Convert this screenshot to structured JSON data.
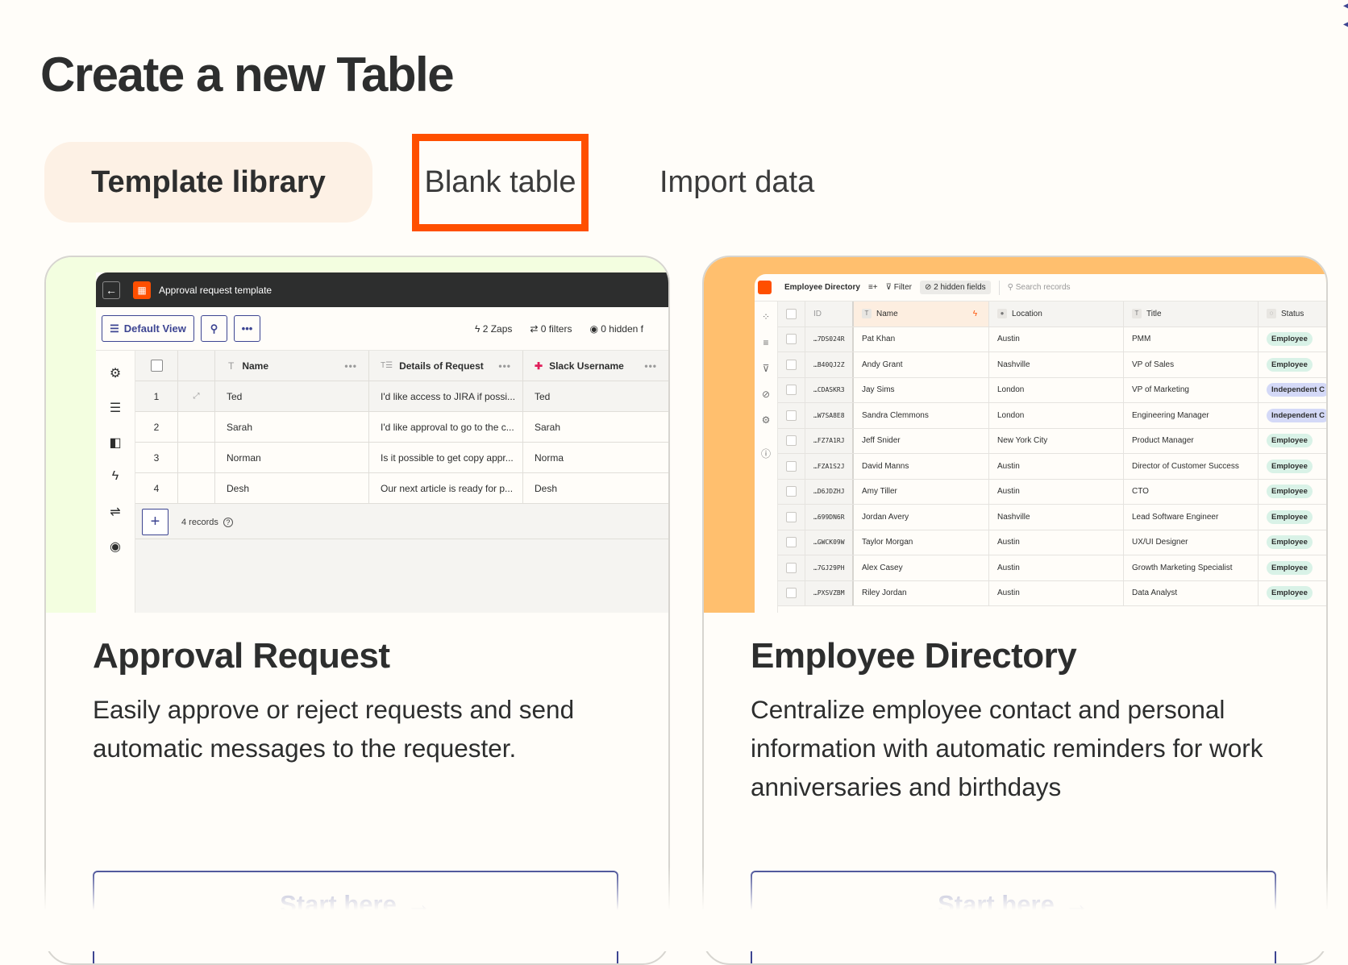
{
  "page": {
    "title": "Create a new Table",
    "tabs": [
      {
        "label": "Template library",
        "selected": true
      },
      {
        "label": "Blank table",
        "highlighted": true
      },
      {
        "label": "Import data"
      }
    ],
    "highlight_color": "#ff4f00"
  },
  "cards": [
    {
      "title": "Approval Request",
      "description": "Easily approve or reject requests and send automatic messages to the requester.",
      "button": "Start here",
      "preview": {
        "window_title": "Approval request template",
        "toolbar": {
          "view": "Default View",
          "zaps": "2 Zaps",
          "filters": "0 filters",
          "hidden": "0 hidden f"
        },
        "columns": [
          "Name",
          "Details of Request",
          "Slack Username"
        ],
        "rows": [
          {
            "n": "1",
            "name": "Ted",
            "details": "I'd like access to JIRA if possi...",
            "slack": "Ted"
          },
          {
            "n": "2",
            "name": "Sarah",
            "details": "I'd like approval to go to the c...",
            "slack": "Sarah"
          },
          {
            "n": "3",
            "name": "Norman",
            "details": "Is it possible to get copy appr...",
            "slack": "Norma"
          },
          {
            "n": "4",
            "name": "Desh",
            "details": "Our next article is ready for p...",
            "slack": "Desh"
          }
        ],
        "records": "4 records"
      }
    },
    {
      "title": "Employee Directory",
      "description": "Centralize employee contact and personal information with automatic reminders for work anniversaries and birthdays",
      "button": "Start here",
      "preview": {
        "table_name": "Employee Directory",
        "filter": "Filter",
        "hidden_fields": "2 hidden fields",
        "search_placeholder": "Search records",
        "columns": [
          "ID",
          "Name",
          "Location",
          "Title",
          "Status"
        ],
        "rows": [
          {
            "id": "…7DS024R",
            "name": "Pat Khan",
            "loc": "Austin",
            "title": "PMM",
            "status": "Employee"
          },
          {
            "id": "…B40QJ2Z",
            "name": "Andy Grant",
            "loc": "Nashville",
            "title": "VP of Sales",
            "status": "Employee"
          },
          {
            "id": "…CDASKR3",
            "name": "Jay Sims",
            "loc": "London",
            "title": "VP of Marketing",
            "status": "Independent C"
          },
          {
            "id": "…W7SA8E8",
            "name": "Sandra Clemmons",
            "loc": "London",
            "title": "Engineering Manager",
            "status": "Independent C"
          },
          {
            "id": "…FZ7A1RJ",
            "name": "Jeff Snider",
            "loc": "New York City",
            "title": "Product Manager",
            "status": "Employee"
          },
          {
            "id": "…FZA1S2J",
            "name": "David Manns",
            "loc": "Austin",
            "title": "Director of Customer Success",
            "status": "Employee"
          },
          {
            "id": "…D6JDZHJ",
            "name": "Amy Tiller",
            "loc": "Austin",
            "title": "CTO",
            "status": "Employee"
          },
          {
            "id": "…699DN6R",
            "name": "Jordan Avery",
            "loc": "Nashville",
            "title": "Lead Software Engineer",
            "status": "Employee"
          },
          {
            "id": "…GWCK09W",
            "name": "Taylor Morgan",
            "loc": "Austin",
            "title": "UX/UI Designer",
            "status": "Employee"
          },
          {
            "id": "…7GJ29PH",
            "name": "Alex Casey",
            "loc": "Austin",
            "title": "Growth Marketing Specialist",
            "status": "Employee"
          },
          {
            "id": "…PXSVZBM",
            "name": "Riley Jordan",
            "loc": "Austin",
            "title": "Data Analyst",
            "status": "Employee"
          }
        ]
      }
    }
  ]
}
